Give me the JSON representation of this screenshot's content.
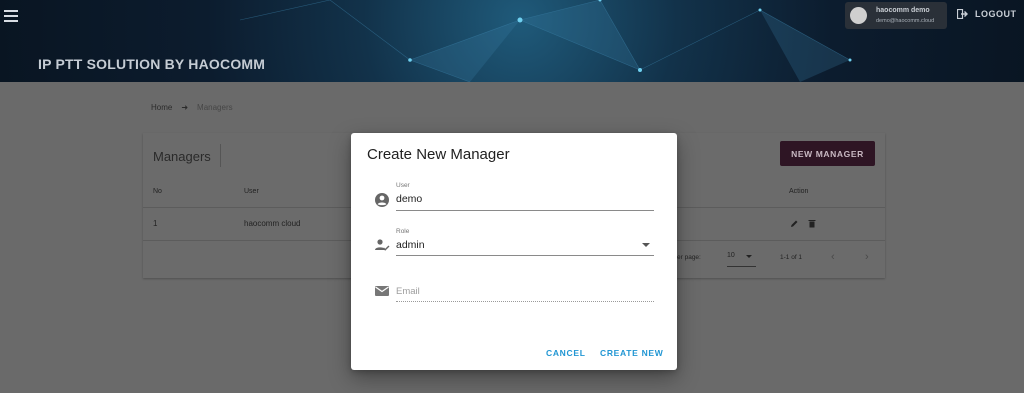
{
  "header": {
    "app_title": "IP PTT SOLUTION BY HAOCOMM",
    "user_name": "haocomm demo",
    "user_email": "demo@haocomm.cloud",
    "logout_label": "LOGOUT",
    "menu_icon": "hamburger-menu-icon",
    "logout_icon": "logout-icon"
  },
  "breadcrumb": {
    "home": "Home",
    "separator": "➜",
    "current": "Managers"
  },
  "managers_card": {
    "title": "Managers",
    "new_button": "NEW MANAGER",
    "columns": [
      "No",
      "User",
      "Action"
    ],
    "rows": [
      {
        "no": "1",
        "user": "haocomm cloud"
      }
    ],
    "pagination": {
      "rows_per_page_label": "er page:",
      "rows_per_page_value": "10",
      "range": "1-1 of 1",
      "prev": "‹",
      "next": "›"
    }
  },
  "dialog": {
    "title": "Create New Manager",
    "user_field": {
      "label": "User",
      "value": "demo",
      "icon": "account-circle-icon"
    },
    "role_field": {
      "label": "Role",
      "value": "admin",
      "icon": "manager-role-icon"
    },
    "email_field": {
      "placeholder": "Email",
      "icon": "email-icon"
    },
    "cancel_label": "CANCEL",
    "create_label": "CREATE NEW"
  },
  "colors": {
    "header_bg": "#0c1c2e",
    "new_button_bg": "#2e1524",
    "dialog_action": "#2196d3",
    "overlay": "#6a6a6a"
  }
}
